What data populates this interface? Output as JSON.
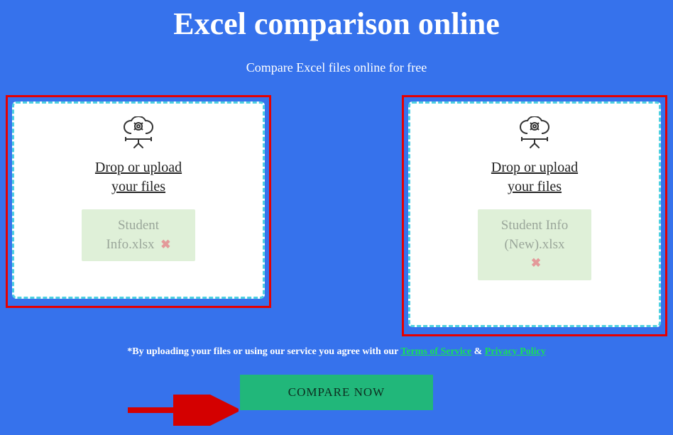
{
  "header": {
    "title": "Excel comparison online",
    "subtitle": "Compare Excel files online for free"
  },
  "dropzones": {
    "left": {
      "label_line1": "Drop or upload",
      "label_line2": "your files",
      "file_name": "Student Info.xlsx"
    },
    "right": {
      "label_line1": "Drop or upload",
      "label_line2": "your files",
      "file_name": "Student Info (New).xlsx"
    }
  },
  "disclaimer": {
    "prefix": "*By uploading your files or using our service you agree with our ",
    "tos_label": "Terms of Service",
    "amp": " & ",
    "privacy_label": "Privacy Policy"
  },
  "buttons": {
    "compare": "COMPARE NOW"
  },
  "icons": {
    "remove_glyph": "✖"
  }
}
